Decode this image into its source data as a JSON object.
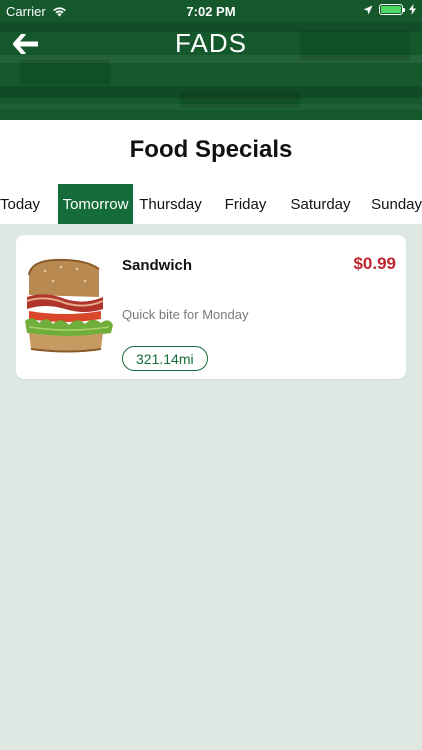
{
  "status_bar": {
    "carrier": "Carrier",
    "time": "7:02 PM"
  },
  "header": {
    "title": "FADS",
    "back_icon": "arrow-left-icon"
  },
  "page": {
    "title": "Food Specials"
  },
  "tabs": [
    {
      "label": "Today",
      "active": false
    },
    {
      "label": "Tomorrow",
      "active": true
    },
    {
      "label": "Thursday",
      "active": false
    },
    {
      "label": "Friday",
      "active": false
    },
    {
      "label": "Saturday",
      "active": false
    },
    {
      "label": "Sunday",
      "active": false
    }
  ],
  "specials": [
    {
      "name": "Sandwich",
      "price": "$0.99",
      "description": "Quick bite for Monday",
      "distance": "321.14mi"
    }
  ],
  "colors": {
    "header_green": "#14582c",
    "accent_green": "#146c3a",
    "price_red": "#c0262d",
    "background": "#dde8e2"
  }
}
